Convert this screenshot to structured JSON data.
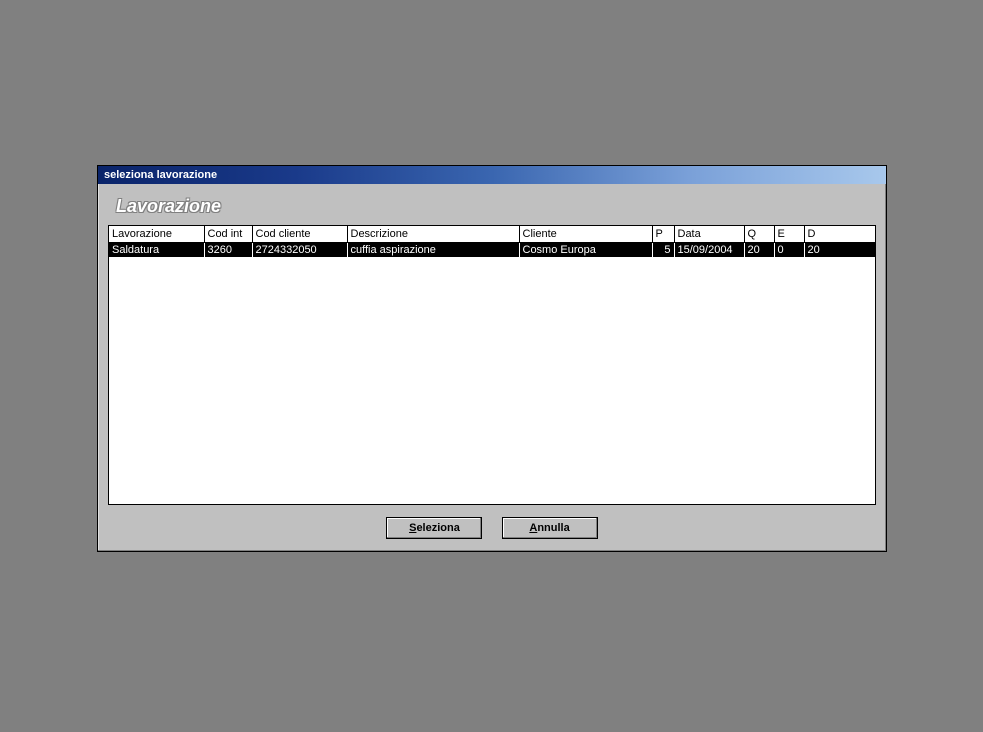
{
  "window": {
    "title": "seleziona lavorazione",
    "heading": "Lavorazione"
  },
  "table": {
    "columns": {
      "lavorazione": "Lavorazione",
      "cod_int": "Cod int",
      "cod_cliente": "Cod cliente",
      "descrizione": "Descrizione",
      "cliente": "Cliente",
      "p": "P",
      "data": "Data",
      "q": "Q",
      "e": "E",
      "d": "D"
    },
    "rows": [
      {
        "lavorazione": "Saldatura",
        "cod_int": "3260",
        "cod_cliente": "2724332050",
        "descrizione": "cuffia aspirazione",
        "cliente": "Cosmo Europa",
        "p": "5",
        "data": "15/09/2004",
        "q": "20",
        "e": "0",
        "d": "20"
      }
    ]
  },
  "buttons": {
    "select": "eleziona",
    "select_accel": "S",
    "cancel": "nnulla",
    "cancel_accel": "A"
  }
}
